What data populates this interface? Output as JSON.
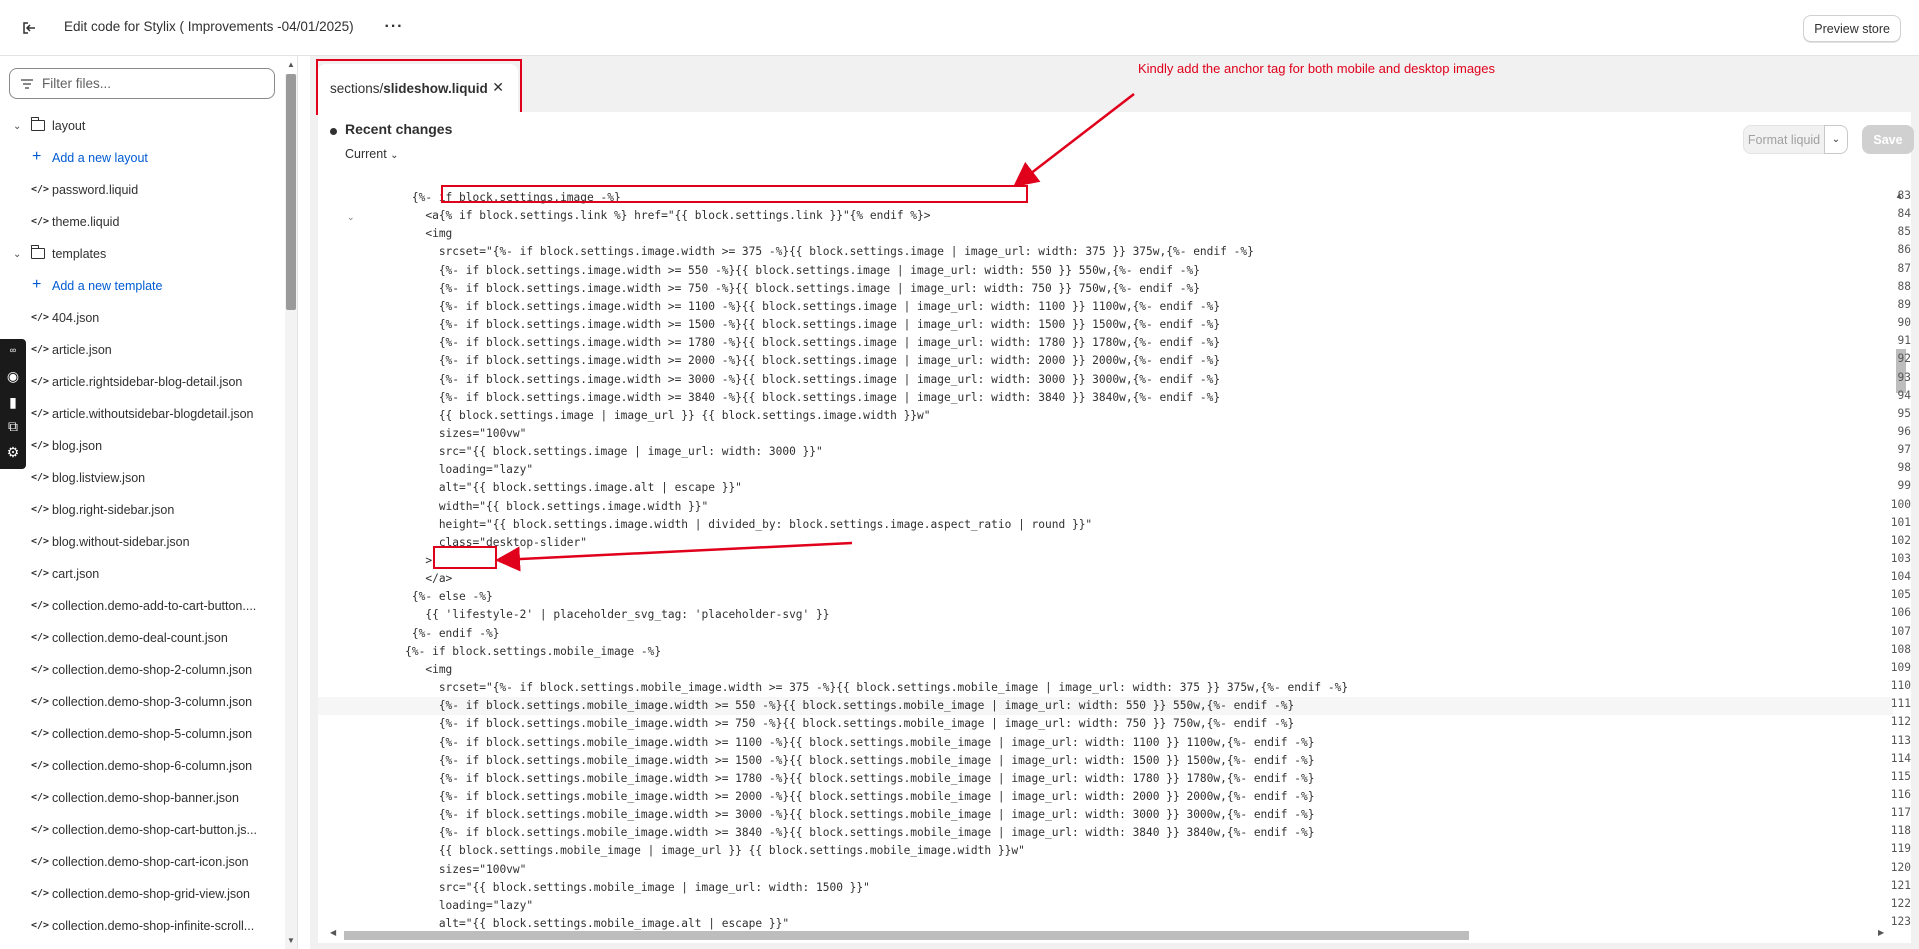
{
  "topbar": {
    "title": "Edit code for Stylix ( Improvements -04/01/2025)",
    "preview_label": "Preview store"
  },
  "sidebar": {
    "filter_placeholder": "Filter files...",
    "layout_folder": "layout",
    "add_layout": "Add a new layout",
    "layout_files": [
      "password.liquid",
      "theme.liquid"
    ],
    "templates_folder": "templates",
    "add_template": "Add a new template",
    "template_files": [
      "404.json",
      "article.json",
      "article.rightsidebar-blog-detail.json",
      "article.withoutsidebar-blogdetail.json",
      "blog.json",
      "blog.listview.json",
      "blog.right-sidebar.json",
      "blog.without-sidebar.json",
      "cart.json",
      "collection.demo-add-to-cart-button....",
      "collection.demo-deal-count.json",
      "collection.demo-shop-2-column.json",
      "collection.demo-shop-3-column.json",
      "collection.demo-shop-5-column.json",
      "collection.demo-shop-6-column.json",
      "collection.demo-shop-banner.json",
      "collection.demo-shop-cart-button.js...",
      "collection.demo-shop-cart-icon.json",
      "collection.demo-shop-grid-view.json",
      "collection.demo-shop-infinite-scroll..."
    ]
  },
  "editor": {
    "tab_prefix": "sections/",
    "tab_file": "slideshow.liquid",
    "annotation": "Kindly add the anchor tag for both mobile and desktop images",
    "recent_changes": "Recent changes",
    "current_label": "Current",
    "format_label": "Format liquid",
    "save_label": "Save",
    "lines": [
      {
        "n": "83",
        "t": "        {%- if block.settings.image -%}"
      },
      {
        "n": "84",
        "t": "          <a{% if block.settings.link %} href=\"{{ block.settings.link }}\"{% endif %}>"
      },
      {
        "n": "85",
        "t": "          <img"
      },
      {
        "n": "86",
        "t": "            srcset=\"{%- if block.settings.image.width >= 375 -%}{{ block.settings.image | image_url: width: 375 }} 375w,{%- endif -%}"
      },
      {
        "n": "87",
        "t": "            {%- if block.settings.image.width >= 550 -%}{{ block.settings.image | image_url: width: 550 }} 550w,{%- endif -%}"
      },
      {
        "n": "88",
        "t": "            {%- if block.settings.image.width >= 750 -%}{{ block.settings.image | image_url: width: 750 }} 750w,{%- endif -%}"
      },
      {
        "n": "89",
        "t": "            {%- if block.settings.image.width >= 1100 -%}{{ block.settings.image | image_url: width: 1100 }} 1100w,{%- endif -%}"
      },
      {
        "n": "90",
        "t": "            {%- if block.settings.image.width >= 1500 -%}{{ block.settings.image | image_url: width: 1500 }} 1500w,{%- endif -%}"
      },
      {
        "n": "91",
        "t": "            {%- if block.settings.image.width >= 1780 -%}{{ block.settings.image | image_url: width: 1780 }} 1780w,{%- endif -%}"
      },
      {
        "n": "92",
        "t": "            {%- if block.settings.image.width >= 2000 -%}{{ block.settings.image | image_url: width: 2000 }} 2000w,{%- endif -%}"
      },
      {
        "n": "93",
        "t": "            {%- if block.settings.image.width >= 3000 -%}{{ block.settings.image | image_url: width: 3000 }} 3000w,{%- endif -%}"
      },
      {
        "n": "94",
        "t": "            {%- if block.settings.image.width >= 3840 -%}{{ block.settings.image | image_url: width: 3840 }} 3840w,{%- endif -%}"
      },
      {
        "n": "95",
        "t": "            {{ block.settings.image | image_url }} {{ block.settings.image.width }}w\""
      },
      {
        "n": "96",
        "t": "            sizes=\"100vw\""
      },
      {
        "n": "97",
        "t": "            src=\"{{ block.settings.image | image_url: width: 3000 }}\""
      },
      {
        "n": "98",
        "t": "            loading=\"lazy\""
      },
      {
        "n": "99",
        "t": "            alt=\"{{ block.settings.image.alt | escape }}\""
      },
      {
        "n": "100",
        "t": "            width=\"{{ block.settings.image.width }}\""
      },
      {
        "n": "101",
        "t": "            height=\"{{ block.settings.image.width | divided_by: block.settings.image.aspect_ratio | round }}\""
      },
      {
        "n": "102",
        "t": "            class=\"desktop-slider\""
      },
      {
        "n": "103",
        "t": "          >"
      },
      {
        "n": "104",
        "t": "          </a>"
      },
      {
        "n": "105",
        "t": "        {%- else -%}"
      },
      {
        "n": "106",
        "t": "          {{ 'lifestyle-2' | placeholder_svg_tag: 'placeholder-svg' }}"
      },
      {
        "n": "107",
        "t": "        {%- endif -%}"
      },
      {
        "n": "108",
        "t": "       {%- if block.settings.mobile_image -%}"
      },
      {
        "n": "109",
        "t": "          <img"
      },
      {
        "n": "110",
        "t": "            srcset=\"{%- if block.settings.mobile_image.width >= 375 -%}{{ block.settings.mobile_image | image_url: width: 375 }} 375w,{%- endif -%}"
      },
      {
        "n": "111",
        "t": "            {%- if block.settings.mobile_image.width >= 550 -%}{{ block.settings.mobile_image | image_url: width: 550 }} 550w,{%- endif -%}"
      },
      {
        "n": "112",
        "t": "            {%- if block.settings.mobile_image.width >= 750 -%}{{ block.settings.mobile_image | image_url: width: 750 }} 750w,{%- endif -%}"
      },
      {
        "n": "113",
        "t": "            {%- if block.settings.mobile_image.width >= 1100 -%}{{ block.settings.mobile_image | image_url: width: 1100 }} 1100w,{%- endif -%}"
      },
      {
        "n": "114",
        "t": "            {%- if block.settings.mobile_image.width >= 1500 -%}{{ block.settings.mobile_image | image_url: width: 1500 }} 1500w,{%- endif -%}"
      },
      {
        "n": "115",
        "t": "            {%- if block.settings.mobile_image.width >= 1780 -%}{{ block.settings.mobile_image | image_url: width: 1780 }} 1780w,{%- endif -%}"
      },
      {
        "n": "116",
        "t": "            {%- if block.settings.mobile_image.width >= 2000 -%}{{ block.settings.mobile_image | image_url: width: 2000 }} 2000w,{%- endif -%}"
      },
      {
        "n": "117",
        "t": "            {%- if block.settings.mobile_image.width >= 3000 -%}{{ block.settings.mobile_image | image_url: width: 3000 }} 3000w,{%- endif -%}"
      },
      {
        "n": "118",
        "t": "            {%- if block.settings.mobile_image.width >= 3840 -%}{{ block.settings.mobile_image | image_url: width: 3840 }} 3840w,{%- endif -%}"
      },
      {
        "n": "119",
        "t": "            {{ block.settings.mobile_image | image_url }} {{ block.settings.mobile_image.width }}w\""
      },
      {
        "n": "120",
        "t": "            sizes=\"100vw\""
      },
      {
        "n": "121",
        "t": "            src=\"{{ block.settings.mobile_image | image_url: width: 1500 }}\""
      },
      {
        "n": "122",
        "t": "            loading=\"lazy\""
      },
      {
        "n": "123",
        "t": "            alt=\"{{ block.settings.mobile_image.alt | escape }}\""
      }
    ]
  }
}
